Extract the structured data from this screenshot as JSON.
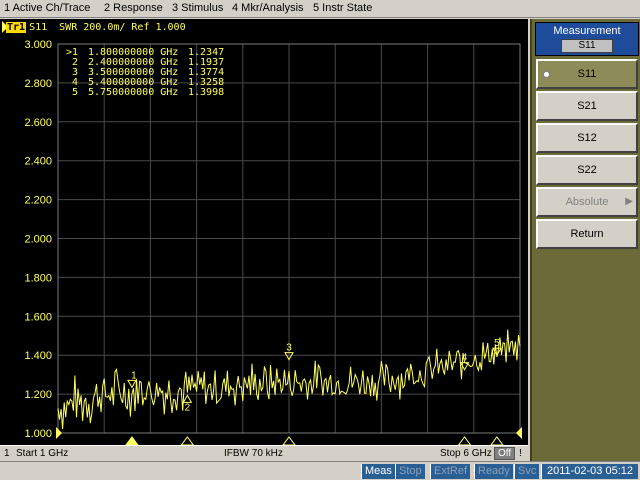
{
  "menu": [
    "1 Active Ch/Trace",
    "2 Response",
    "3 Stimulus",
    "4 Mkr/Analysis",
    "5 Instr State"
  ],
  "trace": {
    "tag": "Tr1",
    "header": "S11  SWR 200.0m/ Ref 1.000",
    "color": "#ffff60"
  },
  "markers": [
    {
      "id": ">1",
      "freq": "1.800000000 GHz",
      "value": "1.2347"
    },
    {
      "id": " 2",
      "freq": "2.400000000 GHz",
      "value": "1.1937"
    },
    {
      "id": " 3",
      "freq": "3.500000000 GHz",
      "value": "1.3774"
    },
    {
      "id": " 4",
      "freq": "5.400000000 GHz",
      "value": "1.3258"
    },
    {
      "id": " 5",
      "freq": "5.750000000 GHz",
      "value": "1.3998"
    }
  ],
  "bottom": {
    "channel": "1",
    "start": "Start 1 GHz",
    "ifbw": "IFBW 70 kHz",
    "stop": "Stop 6 GHz",
    "off": "Off",
    "bang": "!"
  },
  "status": {
    "items": [
      "Meas",
      "Stop",
      "ExtRef",
      "Ready",
      "Svc"
    ],
    "datetime": "2011-02-03 05:12"
  },
  "softkeys": {
    "title": "Measurement",
    "current": "S11",
    "keys": [
      {
        "label": "S11",
        "selected": true
      },
      {
        "label": "S21"
      },
      {
        "label": "S12"
      },
      {
        "label": "S22"
      },
      {
        "label": "Absolute",
        "disabled": true
      },
      {
        "label": "Return"
      }
    ]
  },
  "chart_data": {
    "type": "line",
    "title": "",
    "xlabel": "",
    "ylabel": "",
    "x_range_ghz": [
      1,
      6
    ],
    "ylim": [
      1.0,
      3.0
    ],
    "y_ticks": [
      "3.000",
      "2.800",
      "2.600",
      "2.400",
      "2.200",
      "2.000",
      "1.800",
      "1.600",
      "1.400",
      "1.200",
      "1.000"
    ],
    "grid": true,
    "series": [
      {
        "name": "S11",
        "color": "#ffff60",
        "x": [
          1.0,
          1.5,
          2.0,
          2.5,
          3.0,
          3.5,
          4.0,
          4.5,
          5.0,
          5.5,
          6.0
        ],
        "y": [
          1.13,
          1.2,
          1.22,
          1.22,
          1.25,
          1.26,
          1.26,
          1.27,
          1.32,
          1.38,
          1.45
        ]
      }
    ],
    "markers": [
      {
        "label": "1",
        "x": 1.8,
        "y": 1.2347
      },
      {
        "label": "2",
        "x": 2.4,
        "y": 1.1937
      },
      {
        "label": "3",
        "x": 3.5,
        "y": 1.3774
      },
      {
        "label": "4",
        "x": 5.4,
        "y": 1.3258
      },
      {
        "label": "5",
        "x": 5.75,
        "y": 1.3998
      }
    ]
  }
}
